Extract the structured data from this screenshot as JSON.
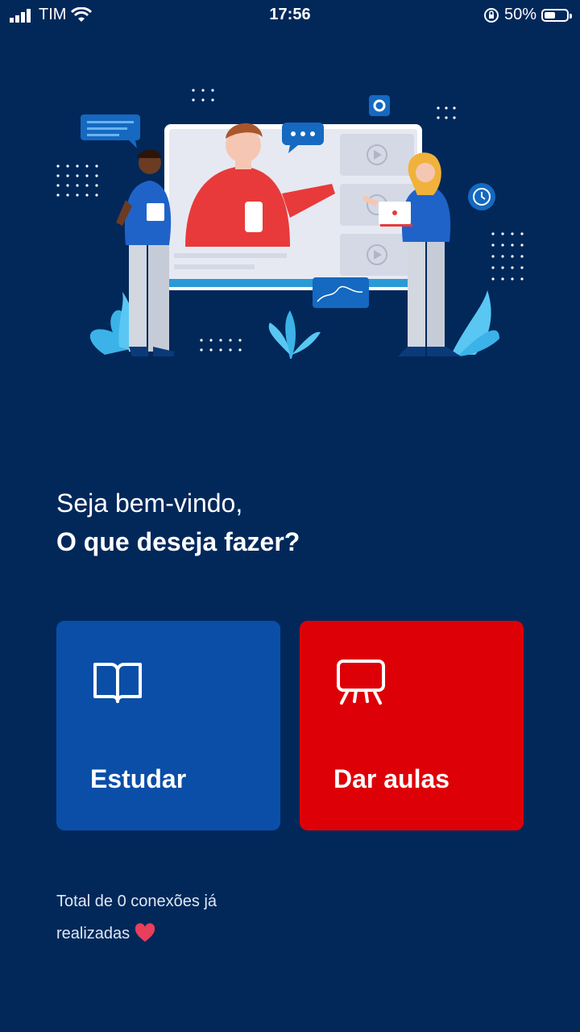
{
  "status_bar": {
    "carrier": "TIM",
    "time": "17:56",
    "battery_percent": "50%",
    "battery_level": 0.5
  },
  "greeting": {
    "line1": "Seja bem-vindo,",
    "line2": "O que deseja fazer?"
  },
  "actions": {
    "study_label": "Estudar",
    "teach_label": "Dar aulas"
  },
  "footer": {
    "text": "Total de 0 conexões já realizadas"
  },
  "colors": {
    "background": "#02285a",
    "study": "#0a4ea8",
    "teach": "#de0007",
    "heart": "#e83f5b"
  },
  "icons": {
    "study": "open-book-icon",
    "teach": "presentation-board-icon",
    "footer": "heart-icon"
  }
}
